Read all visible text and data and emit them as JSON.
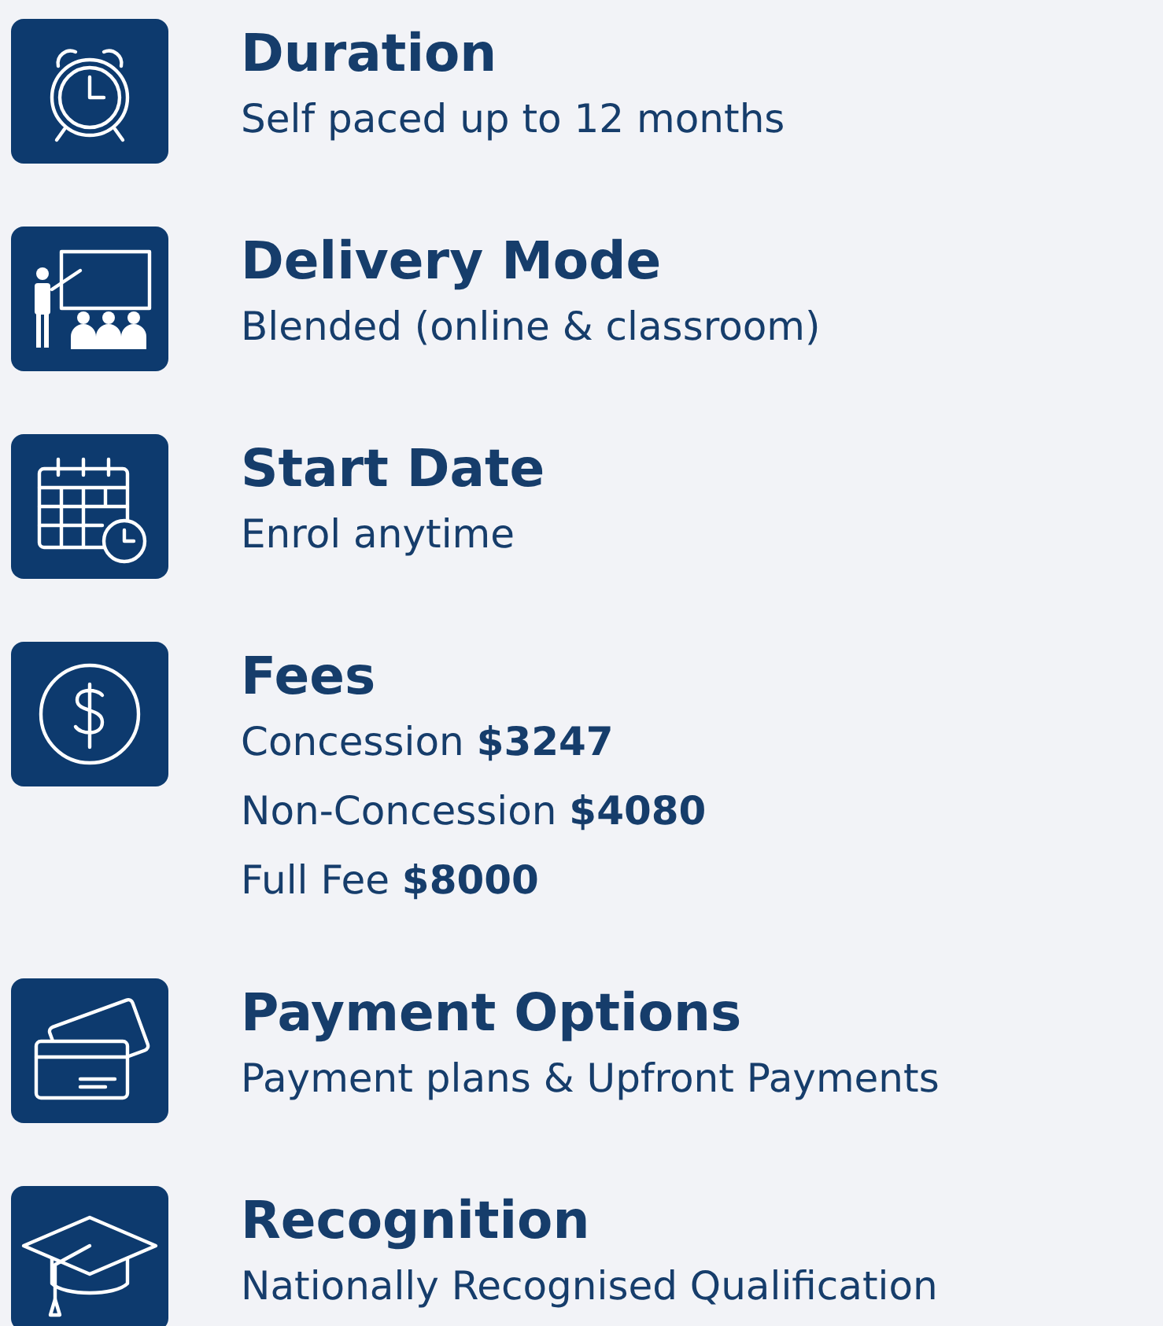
{
  "items": [
    {
      "title": "Duration",
      "lines": [
        "Self paced up to 12 months"
      ]
    },
    {
      "title": "Delivery Mode",
      "lines": [
        "Blended (online & classroom)"
      ]
    },
    {
      "title": "Start Date",
      "lines": [
        "Enrol anytime"
      ]
    },
    {
      "title": "Fees",
      "lines": [
        "Concession **$3247**",
        "Non-Concession **$4080**",
        "Full Fee **$8000**"
      ]
    },
    {
      "title": "Payment Options",
      "lines": [
        "Payment plans & Upfront Payments"
      ]
    },
    {
      "title": "Recognition",
      "lines": [
        "Nationally Recognised Qualification"
      ]
    }
  ]
}
